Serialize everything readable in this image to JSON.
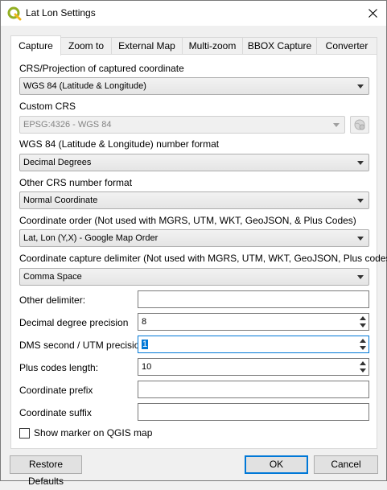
{
  "window": {
    "title": "Lat Lon Settings"
  },
  "tabs": [
    {
      "label": "Capture",
      "active": true
    },
    {
      "label": "Zoom to"
    },
    {
      "label": "External Map"
    },
    {
      "label": "Multi-zoom"
    },
    {
      "label": "BBOX Capture"
    },
    {
      "label": "Converter"
    }
  ],
  "capture": {
    "crs_label": "CRS/Projection of captured coordinate",
    "crs_value": "WGS 84 (Latitude & Longitude)",
    "custom_crs_label": "Custom CRS",
    "custom_crs_value": "EPSG:4326 - WGS 84",
    "wgs_format_label": "WGS 84 (Latitude & Longitude) number format",
    "wgs_format_value": "Decimal Degrees",
    "other_format_label": "Other CRS number format",
    "other_format_value": "Normal Coordinate",
    "order_label": "Coordinate order (Not used with MGRS, UTM, WKT, GeoJSON, & Plus Codes)",
    "order_value": "Lat, Lon (Y,X) - Google Map Order",
    "delim_label": "Coordinate capture delimiter (Not used with MGRS, UTM, WKT, GeoJSON, Plus codes)",
    "delim_value": "Comma Space",
    "other_delim_label": "Other delimiter:",
    "other_delim_value": "",
    "dd_precision_label": "Decimal degree precision",
    "dd_precision_value": "8",
    "dms_precision_label": "DMS second / UTM precision:",
    "dms_precision_value": "1",
    "plus_len_label": "Plus codes length:",
    "plus_len_value": "10",
    "prefix_label": "Coordinate prefix",
    "prefix_value": "",
    "suffix_label": "Coordinate suffix",
    "suffix_value": "",
    "marker_label": "Show marker on QGIS map",
    "marker_checked": false
  },
  "footer": {
    "restore_label": "Restore Defaults",
    "ok_label": "OK",
    "cancel_label": "Cancel"
  },
  "colors": {
    "accent": "#0078d7",
    "qgis_green": "#93b023",
    "qgis_yellow": "#eeb517"
  }
}
